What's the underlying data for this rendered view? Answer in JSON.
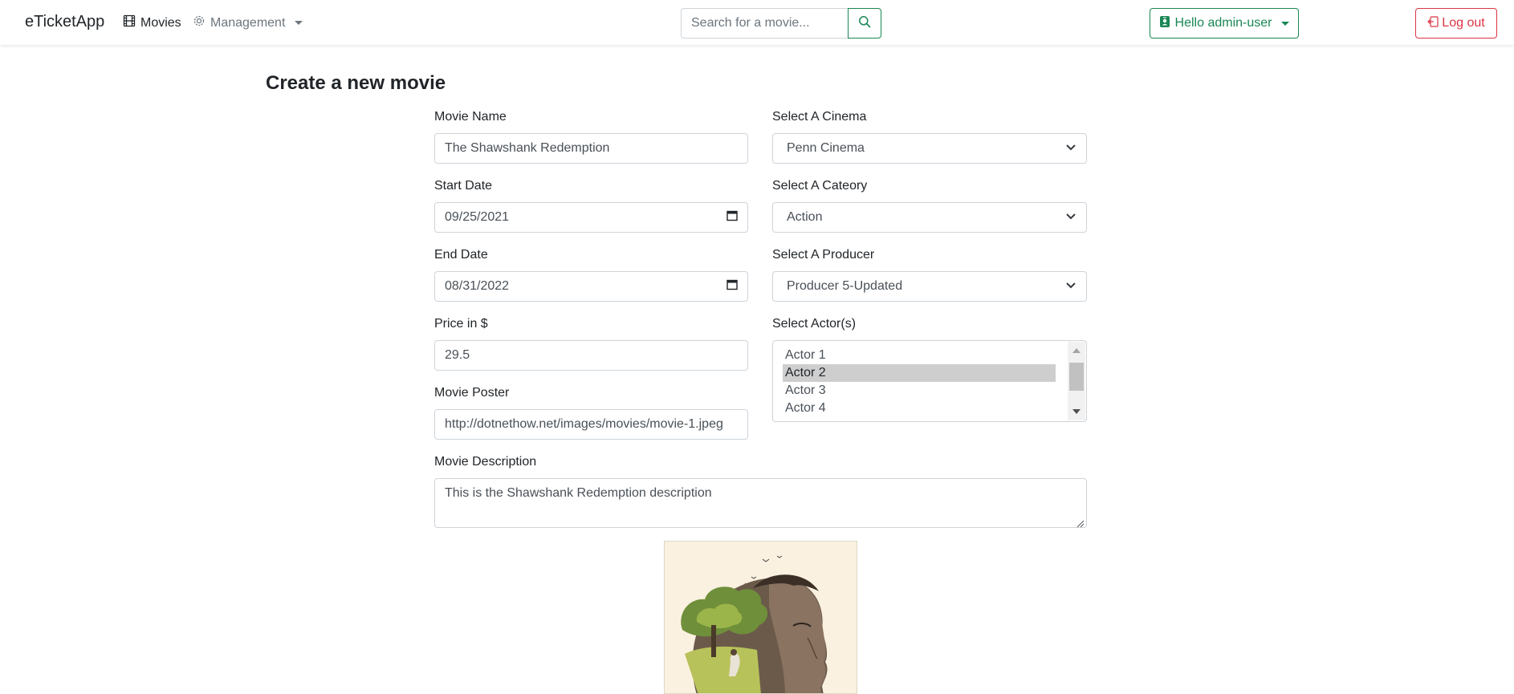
{
  "navbar": {
    "brand": "eTicketApp",
    "movies_label": "Movies",
    "management_label": "Management",
    "search_placeholder": "Search for a movie...",
    "hello_label": "Hello admin-user",
    "logout_label": "Log out"
  },
  "colors": {
    "success": "#198754",
    "danger": "#dc3545",
    "muted": "#6c757d"
  },
  "page": {
    "title": "Create a new movie"
  },
  "form": {
    "movie_name": {
      "label": "Movie Name",
      "value": "The Shawshank Redemption"
    },
    "start_date": {
      "label": "Start Date",
      "value": "09/25/2021"
    },
    "end_date": {
      "label": "End Date",
      "value": "08/31/2022"
    },
    "price": {
      "label": "Price in $",
      "value": "29.5"
    },
    "poster": {
      "label": "Movie Poster",
      "value": "http://dotnethow.net/images/movies/movie-1.jpeg"
    },
    "cinema": {
      "label": "Select A Cinema",
      "value": "Penn Cinema"
    },
    "category": {
      "label": "Select A Cateory",
      "value": "Action"
    },
    "producer": {
      "label": "Select A Producer",
      "value": "Producer 5-Updated"
    },
    "actors": {
      "label": "Select Actor(s)",
      "options": [
        "Actor 1",
        "Actor 2",
        "Actor 3",
        "Actor 4"
      ],
      "selected": "Actor 2"
    },
    "description": {
      "label": "Movie Description",
      "value": "This is the Shawshank Redemption description"
    }
  },
  "icons": {
    "movies": "film-icon",
    "management": "gear-icon",
    "search": "search-icon",
    "hello": "person-badge-icon",
    "logout": "box-arrow-left-icon",
    "date": "calendar-icon",
    "select": "chevron-down-icon"
  }
}
